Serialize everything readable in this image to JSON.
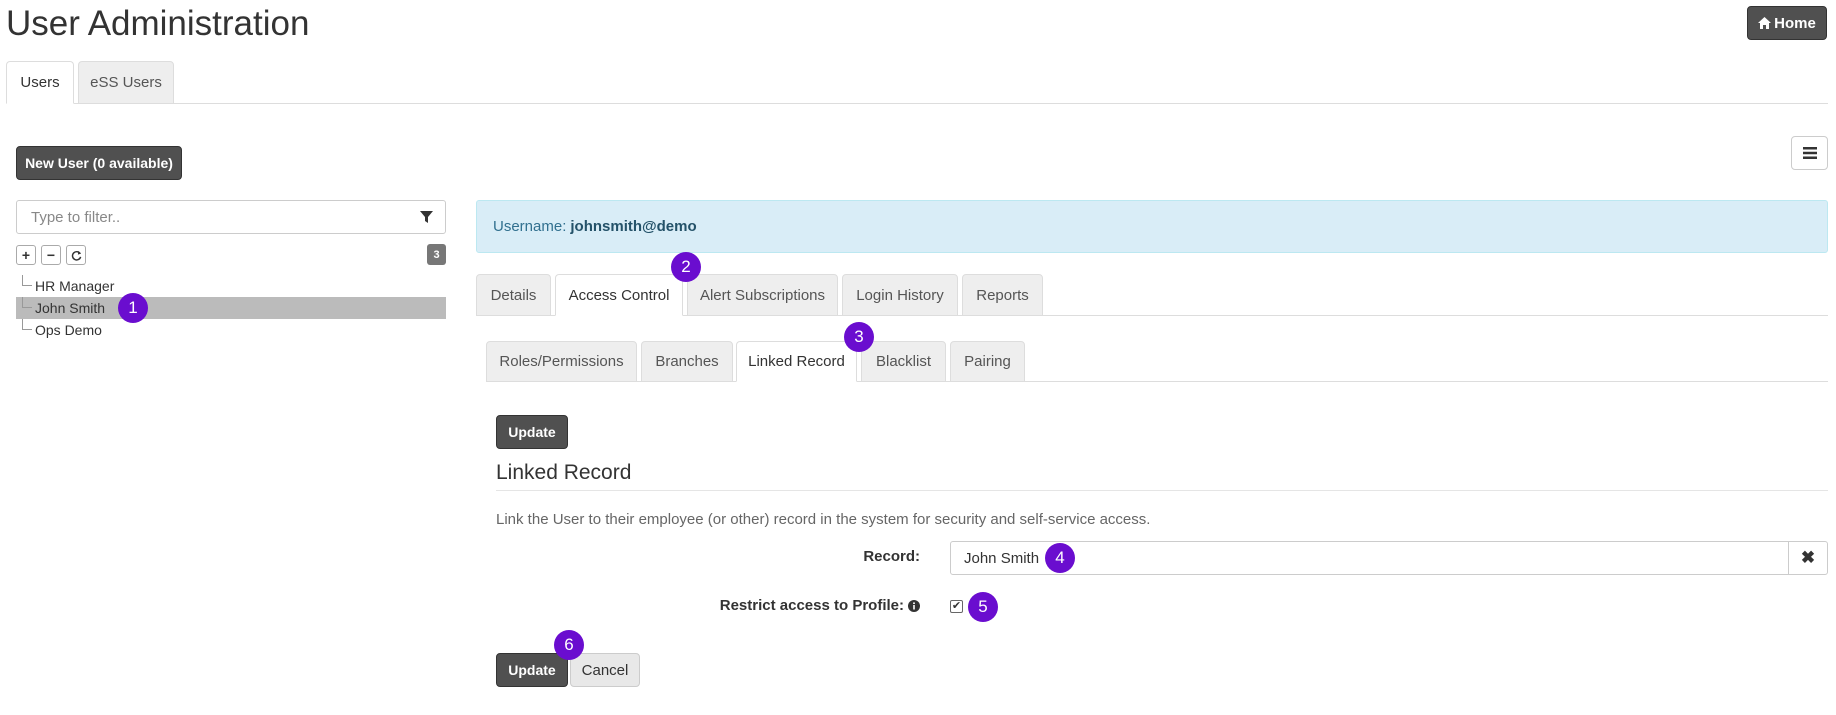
{
  "header": {
    "title": "User Administration",
    "home_button": "Home",
    "home_icon": "home-icon"
  },
  "top_tabs": [
    {
      "label": "Users",
      "active": true
    },
    {
      "label": "eSS Users",
      "active": false
    }
  ],
  "left_panel": {
    "new_user_button": "New User (0 available)",
    "filter_placeholder": "Type to filter..",
    "filter_icon": "filter-icon",
    "tree_controls": {
      "expand": "+",
      "collapse": "−",
      "refresh": "refresh-icon"
    },
    "count": "3",
    "users": [
      {
        "label": "HR Manager",
        "selected": false
      },
      {
        "label": "John Smith",
        "selected": true
      },
      {
        "label": "Ops Demo",
        "selected": false
      }
    ]
  },
  "main": {
    "menu_icon": "hamburger-menu-icon",
    "username_label": "Username:",
    "username_value": "johnsmith@demo",
    "tabs": [
      {
        "label": "Details",
        "active": false
      },
      {
        "label": "Access Control",
        "active": true
      },
      {
        "label": "Alert Subscriptions",
        "active": false
      },
      {
        "label": "Login History",
        "active": false
      },
      {
        "label": "Reports",
        "active": false
      }
    ],
    "subtabs": [
      {
        "label": "Roles/Permissions",
        "active": false
      },
      {
        "label": "Branches",
        "active": false
      },
      {
        "label": "Linked Record",
        "active": true
      },
      {
        "label": "Blacklist",
        "active": false
      },
      {
        "label": "Pairing",
        "active": false
      }
    ],
    "update_top": "Update",
    "section_title": "Linked Record",
    "description": "Link the User to their employee (or other) record in the system for security and self-service access.",
    "record_label": "Record:",
    "record_value": "John Smith",
    "clear_icon": "times-icon",
    "restrict_label": "Restrict access to Profile:",
    "restrict_checked": true,
    "info_icon": "info-circle-icon",
    "update_bottom": "Update",
    "cancel": "Cancel"
  },
  "step_markers": [
    "1",
    "2",
    "3",
    "4",
    "5",
    "6"
  ],
  "colors": {
    "marker": "#6a0dcf",
    "button_dark": "#505050",
    "info_bg": "#d9edf7",
    "selected_row": "#bbbbbb"
  }
}
